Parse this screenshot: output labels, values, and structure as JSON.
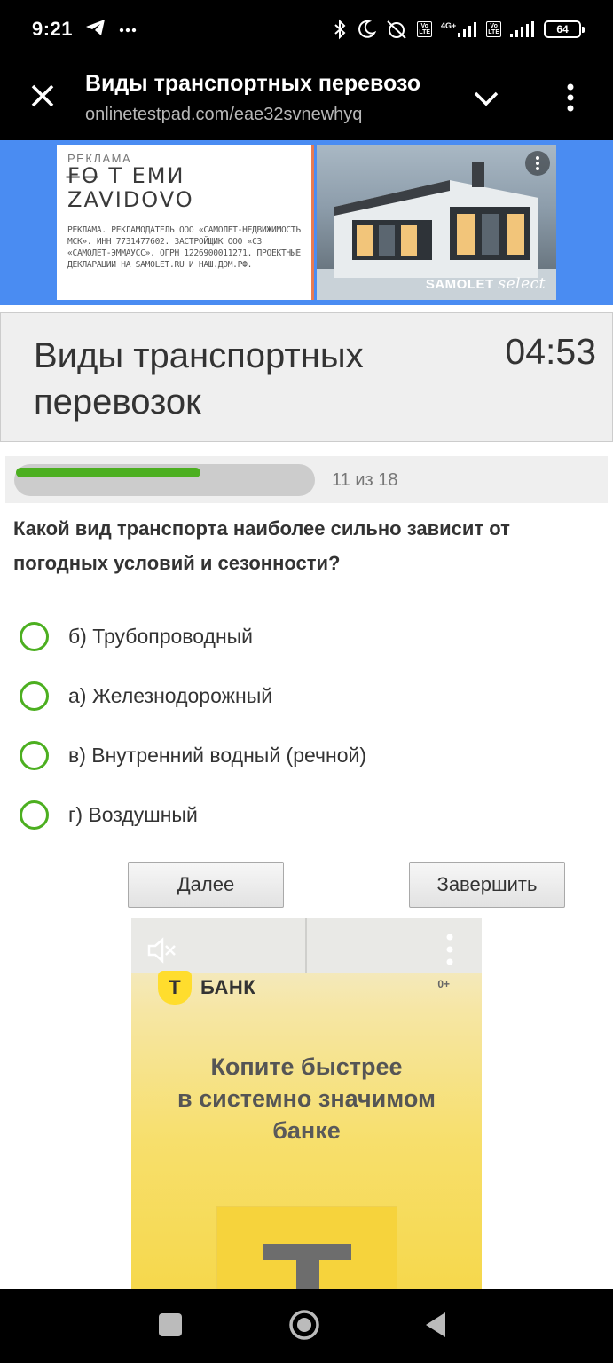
{
  "status_bar": {
    "time": "9:21",
    "battery": "64",
    "icons": [
      "telegram-icon",
      "more-dots-icon",
      "bluetooth-icon",
      "moon-icon",
      "alarm-off-icon",
      "volte-icon",
      "signal-4g-icon",
      "wifi-signal-icon"
    ],
    "network_label": "4G+"
  },
  "browser": {
    "title": "Виды транспортных перевозо",
    "url": "onlinetestpad.com/eae32svnewhyq"
  },
  "ad_top": {
    "label": "РЕКЛАМА",
    "brand_line1": "F̶O̶ T ЕМИ",
    "brand_line2": "ZAVIDOVO",
    "legal": "РЕКЛАМА. РЕКЛАМОДАТЕЛЬ ООО «САМОЛЕТ-НЕДВИЖИМОСТЬ МСК». ИНН 7731477602. ЗАСТРОЙЩИК ООО «СЗ «САМОЛЕТ-ЭММАУСС». ОГРН 1226900011271. ПРОЕКТНЫЕ ДЕКЛАРАЦИИ НА SAMOLET.RU И НАШ.ДОМ.РФ.",
    "logo_main": "SAMOLET",
    "logo_sub": "select"
  },
  "test": {
    "title": "Виды транспортных перевозок",
    "timer": "04:53",
    "progress_text": "11 из 18",
    "progress_value": 0.611,
    "question": "Какой вид транспорта наиболее сильно зависит от погодных условий и сезонности?",
    "options": [
      "б) Трубопроводный",
      "а) Железнодорожный",
      "в) Внутренний водный (речной)",
      "г) Воздушный"
    ],
    "next_label": "Далее",
    "finish_label": "Завершить"
  },
  "ad_bottom": {
    "bank_letter": "Т",
    "bank_name": "БАНК",
    "age": "0+",
    "headline_line1": "Копите быстрее",
    "headline_line2": "в системно значимом",
    "headline_line3": "банке"
  }
}
